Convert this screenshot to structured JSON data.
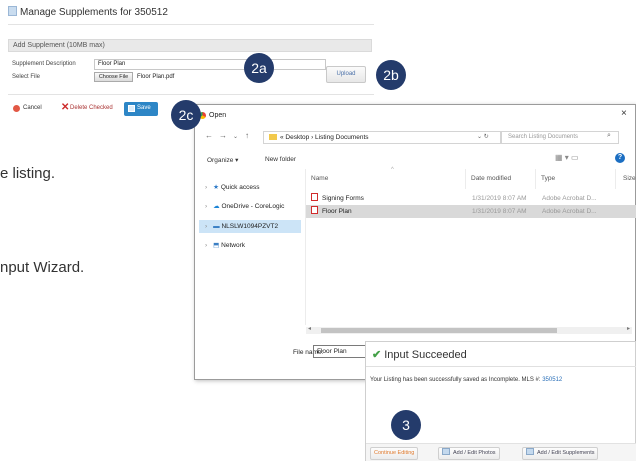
{
  "manage": {
    "title": "Manage Supplements for 350512",
    "section_header": "Add Supplement (10MB max)",
    "desc_label": "Supplement Description",
    "desc_value": "Floor Plan",
    "file_label": "Select File",
    "choose_label": "Choose File",
    "file_value": "Floor Plan.pdf",
    "upload_label": "Upload",
    "cancel_label": "Cancel",
    "delete_label": "Delete Checked",
    "save_label": "Save"
  },
  "badges": {
    "b2a": "2a",
    "b2b": "2b",
    "b2c": "2c",
    "b3": "3"
  },
  "fragments": {
    "f1": "e listing.",
    "f2": "nput Wizard."
  },
  "dialog": {
    "title": "Open",
    "close": "×",
    "path": "« Desktop  ›  Listing Documents",
    "search_placeholder": "Search Listing Documents",
    "organize": "Organize ▾",
    "new_folder": "New folder",
    "sidebar": [
      "Quick access",
      "OneDrive - CoreLogic",
      "NLSLW1094PZVT2",
      "Network"
    ],
    "columns": [
      "Name",
      "Date modified",
      "Type",
      "Size"
    ],
    "files": [
      {
        "name": "Signing Forms",
        "date": "1/31/2019 8:07 AM",
        "type": "Adobe Acrobat D..."
      },
      {
        "name": "Floor Plan",
        "date": "1/31/2019 8:07 AM",
        "type": "Adobe Acrobat D..."
      }
    ],
    "filename_label": "File name:",
    "filename_value": "Floor Plan"
  },
  "success": {
    "title": "Input Succeeded",
    "message": "Your Listing has been successfully saved as Incomplete. MLS #:",
    "mls": "350512",
    "continue_label": "Continue Editing",
    "photos_label": "Add / Edit Photos",
    "supplements_label": "Add / Edit Supplements"
  }
}
